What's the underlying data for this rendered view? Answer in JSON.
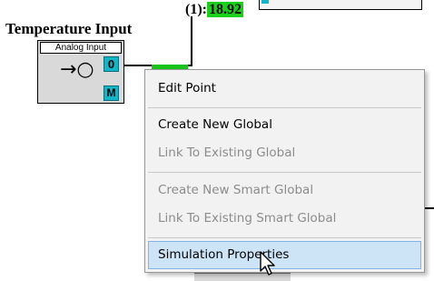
{
  "block": {
    "title": "Temperature Input",
    "label": "Analog Input",
    "arrow_glyph": "→○",
    "output_pin": "0",
    "mode_pin": "M"
  },
  "readout": {
    "prefix": "(1):",
    "value": "18.92"
  },
  "context_menu": {
    "items": [
      {
        "label": "Edit Point",
        "enabled": true
      },
      {
        "label": "Create New Global",
        "enabled": true
      },
      {
        "label": "Link To Existing Global",
        "enabled": false
      },
      {
        "label": "Create New Smart Global",
        "enabled": false
      },
      {
        "label": "Link To Existing Smart Global",
        "enabled": false
      },
      {
        "label": "Simulation Properties",
        "enabled": true,
        "highlighted": true
      }
    ]
  },
  "colors": {
    "pin": "#11b6c9",
    "value_highlight": "#19d119",
    "menu_hover": "#cde4f7"
  }
}
